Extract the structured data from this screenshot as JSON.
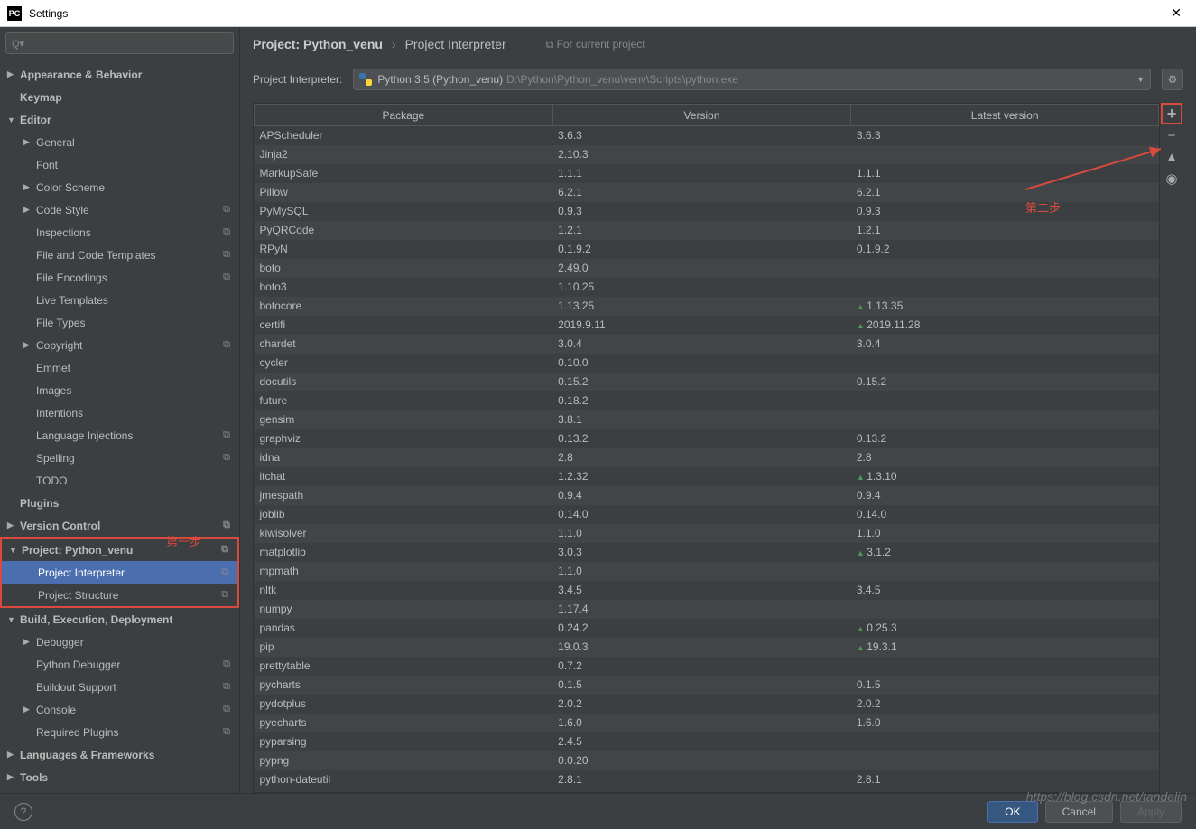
{
  "window": {
    "title": "Settings",
    "icon": "PC"
  },
  "search": {
    "placeholder": "Q▾"
  },
  "tree": [
    {
      "label": "Appearance & Behavior",
      "bold": true,
      "arrow": "▶",
      "depth": 0
    },
    {
      "label": "Keymap",
      "bold": true,
      "depth": 0
    },
    {
      "label": "Editor",
      "bold": true,
      "arrow": "▼",
      "depth": 0
    },
    {
      "label": "General",
      "arrow": "▶",
      "depth": 1
    },
    {
      "label": "Font",
      "depth": 1
    },
    {
      "label": "Color Scheme",
      "arrow": "▶",
      "depth": 1
    },
    {
      "label": "Code Style",
      "arrow": "▶",
      "depth": 1,
      "copy": true
    },
    {
      "label": "Inspections",
      "depth": 1,
      "copy": true
    },
    {
      "label": "File and Code Templates",
      "depth": 1,
      "copy": true
    },
    {
      "label": "File Encodings",
      "depth": 1,
      "copy": true
    },
    {
      "label": "Live Templates",
      "depth": 1
    },
    {
      "label": "File Types",
      "depth": 1
    },
    {
      "label": "Copyright",
      "arrow": "▶",
      "depth": 1,
      "copy": true
    },
    {
      "label": "Emmet",
      "depth": 1
    },
    {
      "label": "Images",
      "depth": 1
    },
    {
      "label": "Intentions",
      "depth": 1
    },
    {
      "label": "Language Injections",
      "depth": 1,
      "copy": true
    },
    {
      "label": "Spelling",
      "depth": 1,
      "copy": true
    },
    {
      "label": "TODO",
      "depth": 1
    },
    {
      "label": "Plugins",
      "bold": true,
      "depth": 0
    },
    {
      "label": "Version Control",
      "bold": true,
      "arrow": "▶",
      "depth": 0,
      "copy": true
    },
    {
      "label": "Project: Python_venu",
      "bold": true,
      "arrow": "▼",
      "depth": 0,
      "copy": true,
      "redbox": true
    },
    {
      "label": "Project Interpreter",
      "depth": 1,
      "copy": true,
      "sel": true,
      "redbox": true
    },
    {
      "label": "Project Structure",
      "depth": 1,
      "copy": true,
      "redbox": true
    },
    {
      "label": "Build, Execution, Deployment",
      "bold": true,
      "arrow": "▼",
      "depth": 0
    },
    {
      "label": "Debugger",
      "arrow": "▶",
      "depth": 1
    },
    {
      "label": "Python Debugger",
      "depth": 1,
      "copy": true
    },
    {
      "label": "Buildout Support",
      "depth": 1,
      "copy": true
    },
    {
      "label": "Console",
      "arrow": "▶",
      "depth": 1,
      "copy": true
    },
    {
      "label": "Required Plugins",
      "depth": 1,
      "copy": true
    },
    {
      "label": "Languages & Frameworks",
      "bold": true,
      "arrow": "▶",
      "depth": 0
    },
    {
      "label": "Tools",
      "bold": true,
      "arrow": "▶",
      "depth": 0
    }
  ],
  "breadcrumb": {
    "project": "Project: Python_venu",
    "page": "Project Interpreter",
    "forcur": "For current project"
  },
  "interpreter": {
    "label": "Project Interpreter:",
    "name": "Python 3.5 (Python_venu)",
    "path": "D:\\Python\\Python_venu\\venv\\Scripts\\python.exe"
  },
  "columns": {
    "package": "Package",
    "version": "Version",
    "latest": "Latest version"
  },
  "packages": [
    {
      "n": "APScheduler",
      "v": "3.6.3",
      "l": "3.6.3"
    },
    {
      "n": "Jinja2",
      "v": "2.10.3",
      "l": ""
    },
    {
      "n": "MarkupSafe",
      "v": "1.1.1",
      "l": "1.1.1"
    },
    {
      "n": "Pillow",
      "v": "6.2.1",
      "l": "6.2.1"
    },
    {
      "n": "PyMySQL",
      "v": "0.9.3",
      "l": "0.9.3"
    },
    {
      "n": "PyQRCode",
      "v": "1.2.1",
      "l": "1.2.1"
    },
    {
      "n": "RPyN",
      "v": "0.1.9.2",
      "l": "0.1.9.2"
    },
    {
      "n": "boto",
      "v": "2.49.0",
      "l": ""
    },
    {
      "n": "boto3",
      "v": "1.10.25",
      "l": ""
    },
    {
      "n": "botocore",
      "v": "1.13.25",
      "l": "1.13.35",
      "u": true
    },
    {
      "n": "certifi",
      "v": "2019.9.11",
      "l": "2019.11.28",
      "u": true
    },
    {
      "n": "chardet",
      "v": "3.0.4",
      "l": "3.0.4"
    },
    {
      "n": "cycler",
      "v": "0.10.0",
      "l": ""
    },
    {
      "n": "docutils",
      "v": "0.15.2",
      "l": "0.15.2"
    },
    {
      "n": "future",
      "v": "0.18.2",
      "l": ""
    },
    {
      "n": "gensim",
      "v": "3.8.1",
      "l": ""
    },
    {
      "n": "graphviz",
      "v": "0.13.2",
      "l": "0.13.2"
    },
    {
      "n": "idna",
      "v": "2.8",
      "l": "2.8"
    },
    {
      "n": "itchat",
      "v": "1.2.32",
      "l": "1.3.10",
      "u": true
    },
    {
      "n": "jmespath",
      "v": "0.9.4",
      "l": "0.9.4"
    },
    {
      "n": "joblib",
      "v": "0.14.0",
      "l": "0.14.0"
    },
    {
      "n": "kiwisolver",
      "v": "1.1.0",
      "l": "1.1.0"
    },
    {
      "n": "matplotlib",
      "v": "3.0.3",
      "l": "3.1.2",
      "u": true
    },
    {
      "n": "mpmath",
      "v": "1.1.0",
      "l": ""
    },
    {
      "n": "nltk",
      "v": "3.4.5",
      "l": "3.4.5"
    },
    {
      "n": "numpy",
      "v": "1.17.4",
      "l": ""
    },
    {
      "n": "pandas",
      "v": "0.24.2",
      "l": "0.25.3",
      "u": true
    },
    {
      "n": "pip",
      "v": "19.0.3",
      "l": "19.3.1",
      "u": true
    },
    {
      "n": "prettytable",
      "v": "0.7.2",
      "l": ""
    },
    {
      "n": "pycharts",
      "v": "0.1.5",
      "l": "0.1.5"
    },
    {
      "n": "pydotplus",
      "v": "2.0.2",
      "l": "2.0.2"
    },
    {
      "n": "pyecharts",
      "v": "1.6.0",
      "l": "1.6.0"
    },
    {
      "n": "pyparsing",
      "v": "2.4.5",
      "l": ""
    },
    {
      "n": "pypng",
      "v": "0.0.20",
      "l": ""
    },
    {
      "n": "python-dateutil",
      "v": "2.8.1",
      "l": "2.8.1"
    }
  ],
  "annotations": {
    "step1": "第一步",
    "step2": "第二步"
  },
  "buttons": {
    "ok": "OK",
    "cancel": "Cancel",
    "apply": "Apply"
  },
  "watermark": "https://blog.csdn.net/tandelin"
}
